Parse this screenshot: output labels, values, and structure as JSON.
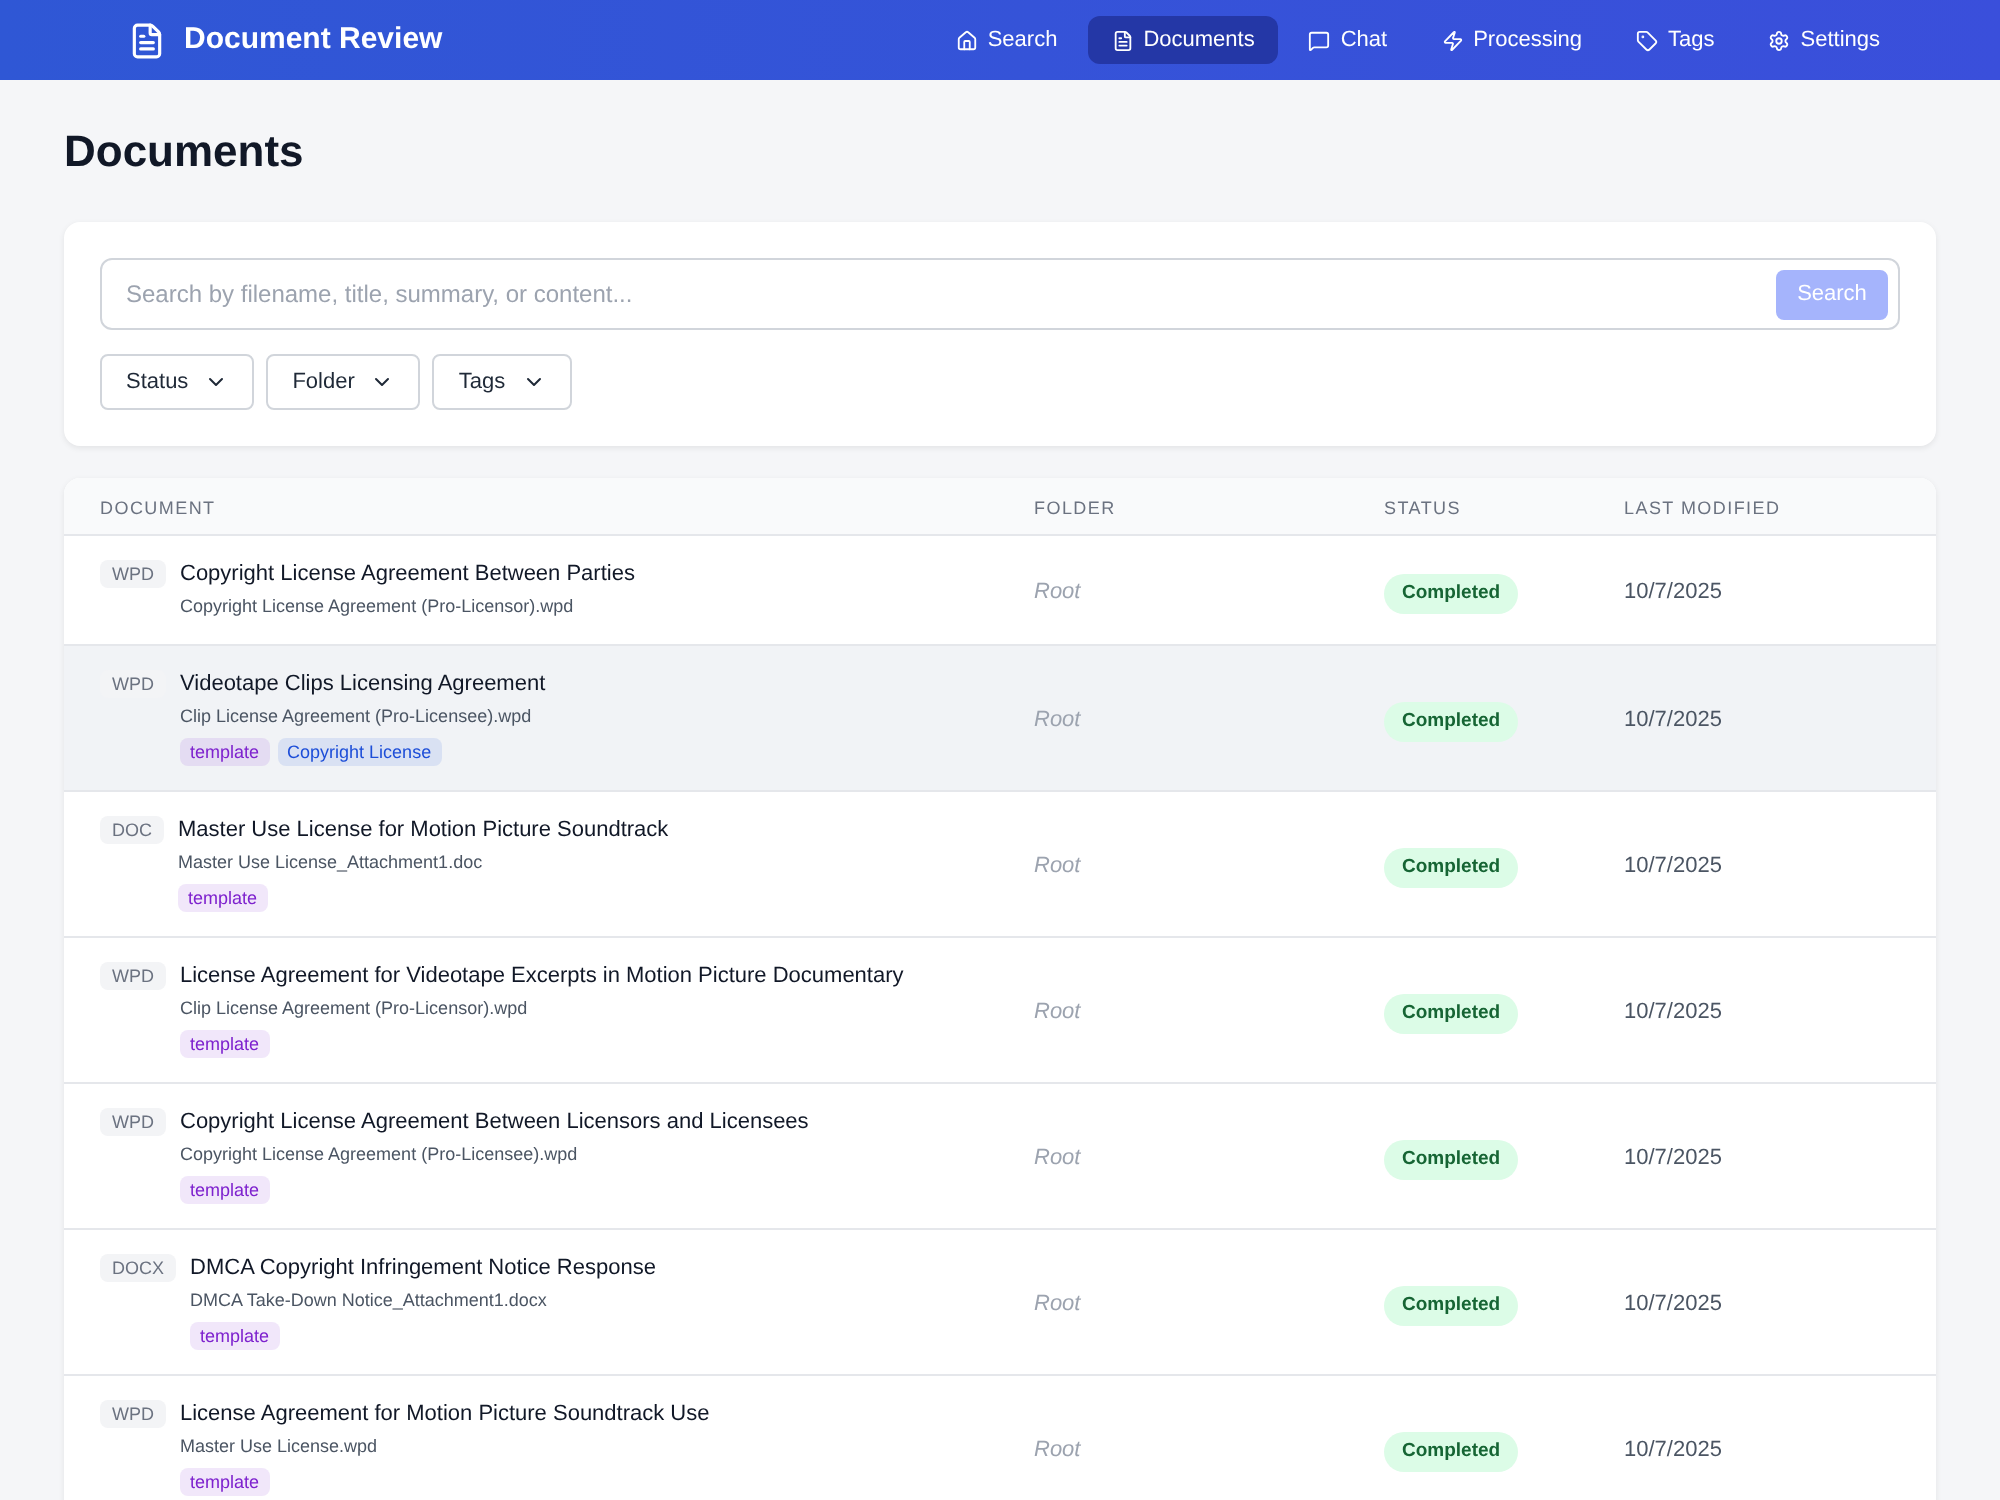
{
  "header": {
    "title": "Document Review",
    "nav": [
      {
        "label": "Search",
        "selected": false
      },
      {
        "label": "Documents",
        "selected": true
      },
      {
        "label": "Chat",
        "selected": false
      },
      {
        "label": "Processing",
        "selected": false
      },
      {
        "label": "Tags",
        "selected": false
      },
      {
        "label": "Settings",
        "selected": false
      }
    ]
  },
  "page_title": "Documents",
  "filter": {
    "search": {
      "placeholder": "Search by filename, title, summary, or content..."
    },
    "search_button": {
      "label": "Search",
      "disabled": true
    },
    "dropdowns": [
      "Status",
      "Folder",
      "Tags"
    ]
  },
  "table": {
    "columns": [
      "DOCUMENT",
      "FOLDER",
      "STATUS",
      "LAST MODIFIED"
    ],
    "rows": [
      {
        "type": "WPD",
        "title": "Copyright License Agreement Between Parties",
        "filename": "Copyright License Agreement (Pro-Licensor).wpd",
        "tags": [],
        "folder": "Root",
        "status": "Completed",
        "modified": "10/7/2025",
        "highlighted": false
      },
      {
        "type": "WPD",
        "title": "Videotape Clips Licensing Agreement",
        "filename": "Clip License Agreement (Pro-Licensee).wpd",
        "tags": [
          {
            "label": "template",
            "color": "#7e22ce"
          },
          {
            "label": "Copyright License",
            "color": "#1d4ed8"
          }
        ],
        "folder": "Root",
        "status": "Completed",
        "modified": "10/7/2025",
        "highlighted": true
      },
      {
        "type": "DOC",
        "title": "Master Use License for Motion Picture Soundtrack",
        "filename": "Master Use License_Attachment1.doc",
        "tags": [
          {
            "label": "template",
            "color": "#7e22ce"
          }
        ],
        "folder": "Root",
        "status": "Completed",
        "modified": "10/7/2025",
        "highlighted": false
      },
      {
        "type": "WPD",
        "title": "License Agreement for Videotape Excerpts in Motion Picture Documentary",
        "filename": "Clip License Agreement (Pro-Licensor).wpd",
        "tags": [
          {
            "label": "template",
            "color": "#7e22ce"
          }
        ],
        "folder": "Root",
        "status": "Completed",
        "modified": "10/7/2025",
        "highlighted": false
      },
      {
        "type": "WPD",
        "title": "Copyright License Agreement Between Licensors and Licensees",
        "filename": "Copyright License Agreement (Pro-Licensee).wpd",
        "tags": [
          {
            "label": "template",
            "color": "#7e22ce"
          }
        ],
        "folder": "Root",
        "status": "Completed",
        "modified": "10/7/2025",
        "highlighted": false
      },
      {
        "type": "DOCX",
        "title": "DMCA Copyright Infringement Notice Response",
        "filename": "DMCA Take-Down Notice_Attachment1.docx",
        "tags": [
          {
            "label": "template",
            "color": "#7e22ce"
          }
        ],
        "folder": "Root",
        "status": "Completed",
        "modified": "10/7/2025",
        "highlighted": false
      },
      {
        "type": "WPD",
        "title": "License Agreement for Motion Picture Soundtrack Use",
        "filename": "Master Use License.wpd",
        "tags": [
          {
            "label": "template",
            "color": "#7e22ce"
          }
        ],
        "folder": "Root",
        "status": "Completed",
        "modified": "10/7/2025",
        "highlighted": false
      }
    ]
  }
}
